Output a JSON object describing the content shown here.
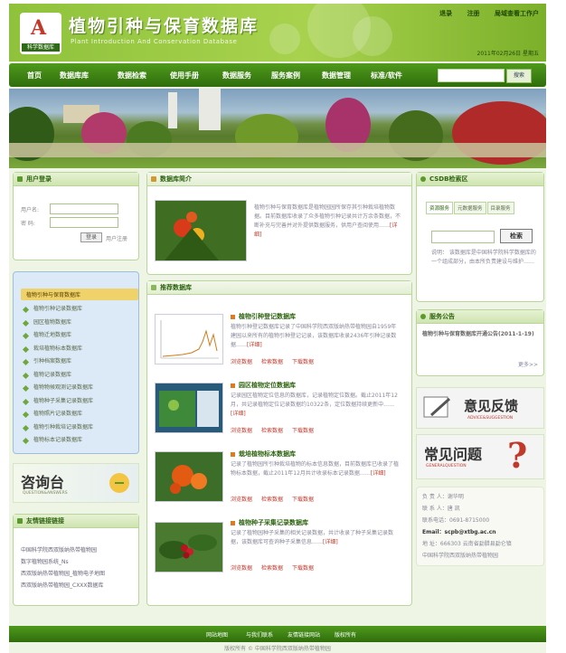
{
  "header": {
    "logo_mark": "A",
    "logo_caption": "科学数据库",
    "title": "植物引种与保育数据库",
    "subtitle": "Plant Introduction And Conservation Database",
    "top_links": [
      "退录",
      "注册",
      "局域查看工作户"
    ],
    "date": "2011年02月26日 星期五"
  },
  "nav": {
    "items": [
      "首页",
      "数据库库",
      "数据检索",
      "使用手册",
      "数据服务",
      "服务案例",
      "数据管理",
      "标准/软件"
    ],
    "search_placeholder": "",
    "search_button": "搜索"
  },
  "login": {
    "title": "用户登录",
    "user_label": "用户名:",
    "pass_label": "密  码:",
    "login_button": "登录",
    "register_link": "用户注册"
  },
  "dblist": {
    "heading": "植物引种与保育数据库",
    "items": [
      "植物引种记录数据库",
      "园区植物数据库",
      "植物迁地数据库",
      "栽培植物标本数据库",
      "引种档案数据库",
      "植物记录数据库",
      "植物物候观测记录数据库",
      "植物种子采集记录数据库",
      "植物照片记录数据库",
      "植物引种栽培记录数据库",
      "植物标本记录数据库"
    ]
  },
  "consult": {
    "title": "咨询台",
    "sub": "QUESTION&ANSWERS"
  },
  "friend_links": {
    "title": "友情链接链接",
    "items": [
      "中国科学院西双版纳热带植物园",
      "数字植物园系统_Ns",
      "西双版纳热带植物园_植物电子地图",
      "西双版纳热带植物园_CXXX数据库"
    ]
  },
  "intro": {
    "title": "数据库简介",
    "text": "植物引种与保育数据库是植物园园所保存其引种栽培植物数据。目前数据库收录了众多植物引种记录共计万余条数据，不断补充与完善并对外提供数据服务，供用户查阅使用……",
    "more": "[详细]"
  },
  "recommend": {
    "title": "推荐数据库",
    "entries": [
      {
        "title": "植物引种登记数据库",
        "text": "植物引种登记数据库记录了中国科学院西双版纳热带植物园自1959年建园以来所有的植物引种登记记录，该数据库收录2436年引种记录数据……",
        "more": "[详细]",
        "actions": [
          "浏览数据",
          "检索数据",
          "下载数据"
        ]
      },
      {
        "title": "园区植物定位数据库",
        "text": "记录园区植物定位信息的数据库，记录植物定位数据。截止2011年12月，共记录植物定位记录数据约10322条，定位数据持续更新中……",
        "more": "[详细]",
        "actions": [
          "浏览数据",
          "检索数据",
          "下载数据"
        ]
      },
      {
        "title": "栽培植物标本数据库",
        "text": "记录了植物园所引种栽培植物的标本信息数据，目前数据库已收录了植物标本数据，截止2011年12月共计收录标本记录数据……",
        "more": "[详细]",
        "actions": [
          "浏览数据",
          "检索数据",
          "下载数据"
        ]
      },
      {
        "title": "植物种子采集记录数据库",
        "text": "记录了植物园种子采集的相关记录数据，共计收录了种子采集记录数据，该数据库可查询种子采集信息……",
        "more": "[详细]",
        "actions": [
          "浏览数据",
          "检索数据",
          "下载数据"
        ]
      }
    ]
  },
  "csdb": {
    "title": "CSDB检索区",
    "tabs": [
      "资源服务",
      "元数据服务",
      "目录服务"
    ],
    "search_button": "检索",
    "note": "说明：  该数据库是中国科学院科学数据库的一个组成部分，由本所负责建设与维护……"
  },
  "announce": {
    "title": "服务公告",
    "text": "植物引种与保育数据库开通公告(2011-1-19)",
    "more": "更多>>"
  },
  "feedback": {
    "title": "意见反馈",
    "sub": "ADVICE&SUGGESTION"
  },
  "faq": {
    "title": "常见问题",
    "sub": "GENERALQUESTION"
  },
  "contact": {
    "lines": [
      "负 责 人：谢华明",
      "联 系 人：唐  凯",
      "联系电话：0691-8715000",
      "Email：scpb@xtbg.ac.cn",
      "地    址：666303 云南省勐腊县勐仑镇",
      "中国科学院西双版纳热带植物园"
    ]
  },
  "footer": {
    "links": [
      "网站地图",
      "与我们联系",
      "友情链接网站",
      "版权所有"
    ],
    "copyright": "版权所有 © 中国科学院西双版纳热带植物园"
  },
  "colors": {
    "brand": "#5a9a2a",
    "nav": "#3d8015",
    "accent": "#c0392b"
  }
}
